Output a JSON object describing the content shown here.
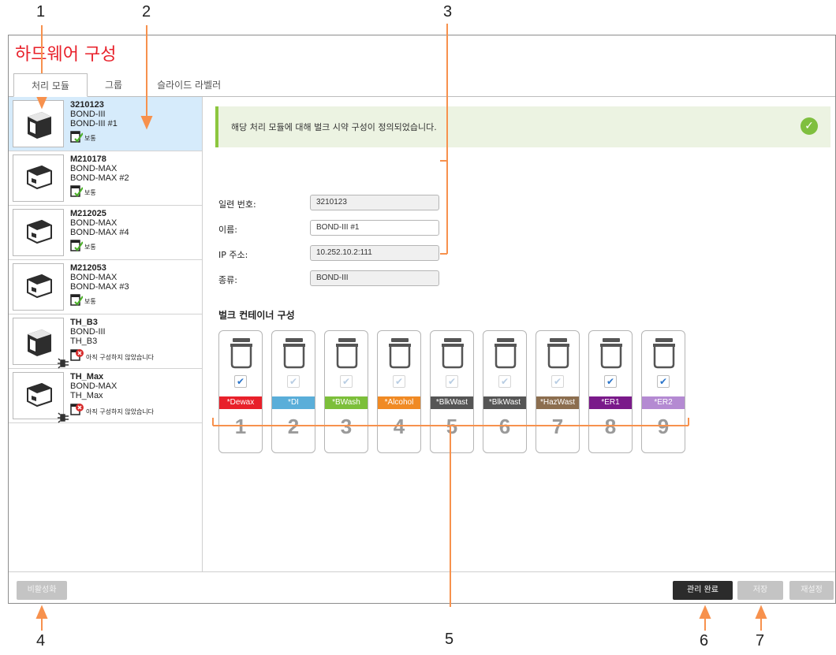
{
  "title": "하드웨어 구성",
  "tabs": [
    {
      "label": "처리 모듈",
      "active": true
    },
    {
      "label": "그룹",
      "active": false
    },
    {
      "label": "슬라이드 라벨러",
      "active": false
    }
  ],
  "modules": [
    {
      "serial": "3210123",
      "type": "BOND-III",
      "name": "BOND-III  #1",
      "status": "보통",
      "configured": true,
      "selected": true,
      "model": "III"
    },
    {
      "serial": "M210178",
      "type": "BOND-MAX",
      "name": "BOND-MAX #2",
      "status": "보통",
      "configured": true,
      "selected": false,
      "model": "MAX"
    },
    {
      "serial": "M212025",
      "type": "BOND-MAX",
      "name": "BOND-MAX #4",
      "status": "보통",
      "configured": true,
      "selected": false,
      "model": "MAX"
    },
    {
      "serial": "M212053",
      "type": "BOND-MAX",
      "name": "BOND-MAX #3",
      "status": "보통",
      "configured": true,
      "selected": false,
      "model": "MAX"
    },
    {
      "serial": "TH_B3",
      "type": "BOND-III",
      "name": "TH_B3",
      "status": "아직 구성하지 않았습니다",
      "configured": false,
      "selected": false,
      "model": "III"
    },
    {
      "serial": "TH_Max",
      "type": "BOND-MAX",
      "name": "TH_Max",
      "status": "아직 구성하지 않았습니다",
      "configured": false,
      "selected": false,
      "model": "MAX"
    }
  ],
  "banner": {
    "text": "해당 처리 모듈에 대해 벌크 시약 구성이 정의되었습니다."
  },
  "fields": {
    "serial": {
      "label": "일련 번호:",
      "value": "3210123"
    },
    "name": {
      "label": "이름:",
      "value": "BOND-III  #1"
    },
    "ip": {
      "label": "IP 주소:",
      "value": "10.252.10.2:111"
    },
    "kind": {
      "label": "종류:",
      "value": "BOND-III"
    }
  },
  "bulk_title": "벌크 컨테이너 구성",
  "containers": [
    {
      "label": "*Dewax",
      "num": "1",
      "color": "#e8202a",
      "checked": true,
      "enabled": true
    },
    {
      "label": "*DI",
      "num": "2",
      "color": "#5aaed9",
      "checked": true,
      "enabled": false
    },
    {
      "label": "*BWash",
      "num": "3",
      "color": "#7cbf3a",
      "checked": true,
      "enabled": false
    },
    {
      "label": "*Alcohol",
      "num": "4",
      "color": "#f08a24",
      "checked": true,
      "enabled": false
    },
    {
      "label": "*BlkWast",
      "num": "5",
      "color": "#555555",
      "checked": true,
      "enabled": false
    },
    {
      "label": "*BlkWast",
      "num": "6",
      "color": "#555555",
      "checked": true,
      "enabled": false
    },
    {
      "label": "*HazWast",
      "num": "7",
      "color": "#8c6e4f",
      "checked": true,
      "enabled": false
    },
    {
      "label": "*ER1",
      "num": "8",
      "color": "#7a1a8a",
      "checked": true,
      "enabled": true
    },
    {
      "label": "*ER2",
      "num": "9",
      "color": "#b48ad2",
      "checked": true,
      "enabled": true
    }
  ],
  "buttons": {
    "deactivate": "비활성화",
    "done": "관리 완료",
    "save": "저장",
    "reset": "재설정"
  },
  "callouts": [
    "1",
    "2",
    "3",
    "4",
    "5",
    "6",
    "7"
  ],
  "colors": {
    "accent": "#f7914d",
    "title": "#e8202a",
    "selected": "#d6ebfb"
  }
}
